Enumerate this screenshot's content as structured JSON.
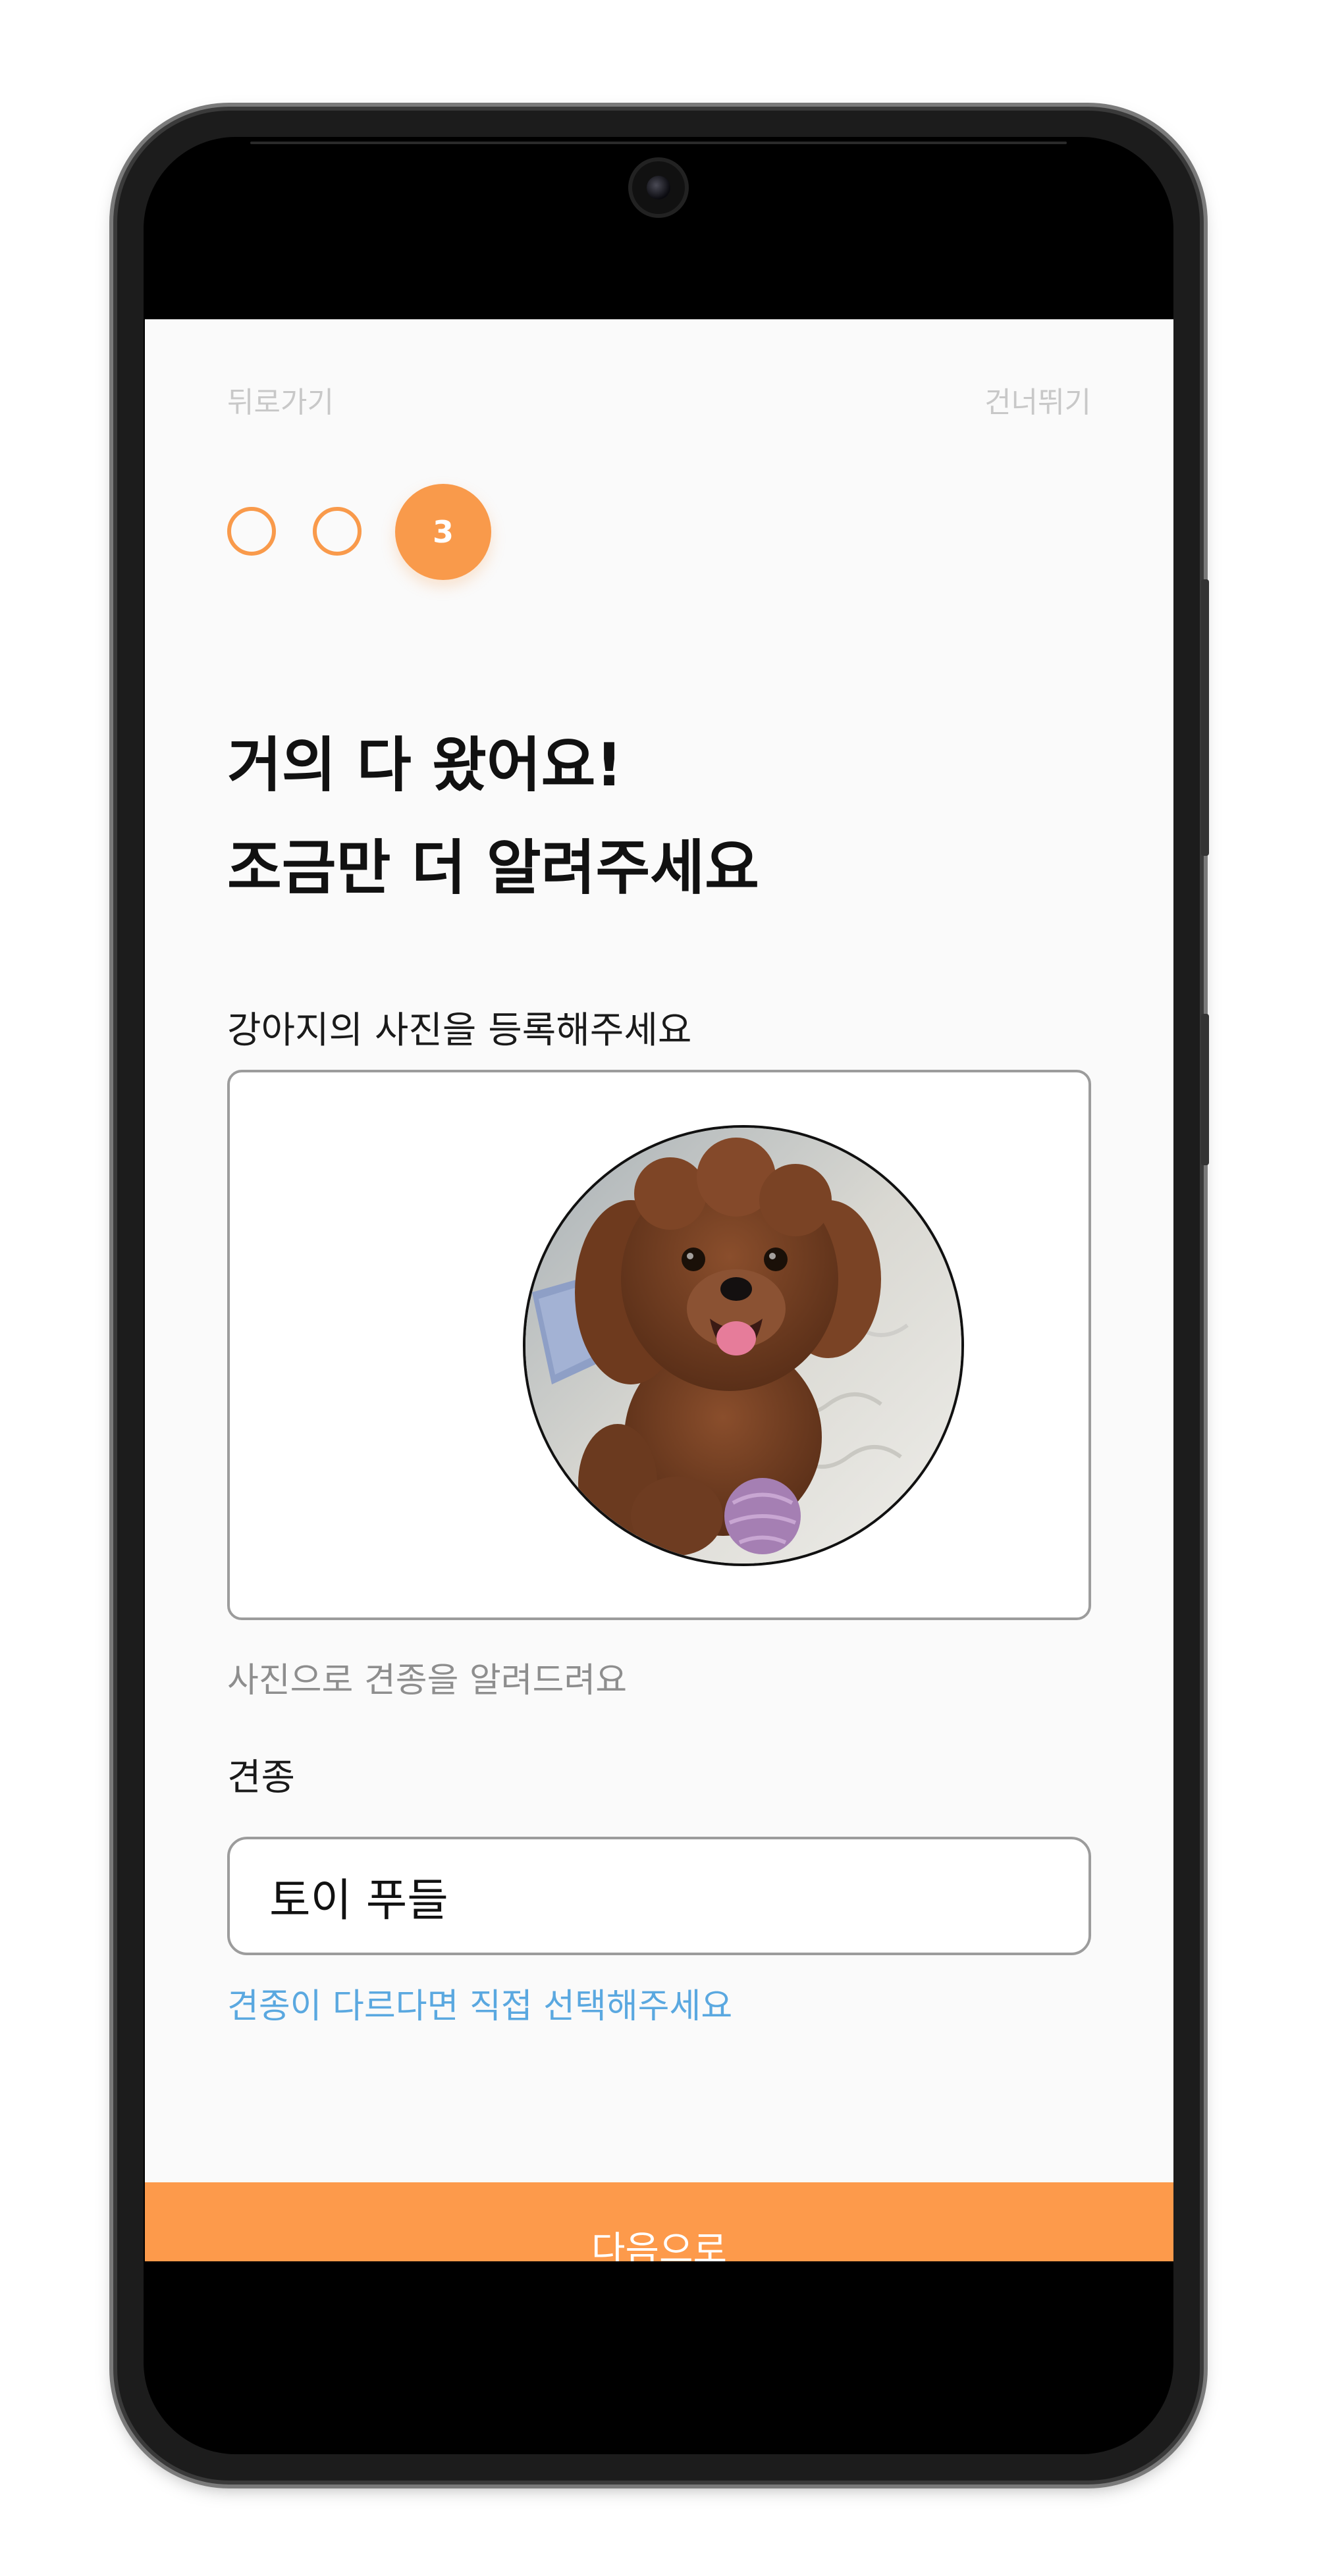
{
  "nav": {
    "back_label": "뒤로가기",
    "skip_label": "건너뛰기"
  },
  "steps": {
    "current": "3",
    "total": 3
  },
  "header": {
    "title_line1": "거의 다 왔어요!",
    "title_line2": "조금만 더 알려주세요"
  },
  "photo_section": {
    "label": "강아지의 사진을 등록해주세요",
    "hint": "사진으로 견종을 알려드려요"
  },
  "breed_section": {
    "label": "견종",
    "value": "토이 푸들",
    "change_link": "견종이 다르다면 직접 선택해주세요"
  },
  "footer": {
    "next_label": "다음으로"
  },
  "colors": {
    "accent": "#fd9a4b",
    "link": "#5aa8e0",
    "muted": "#8e8e8e"
  }
}
